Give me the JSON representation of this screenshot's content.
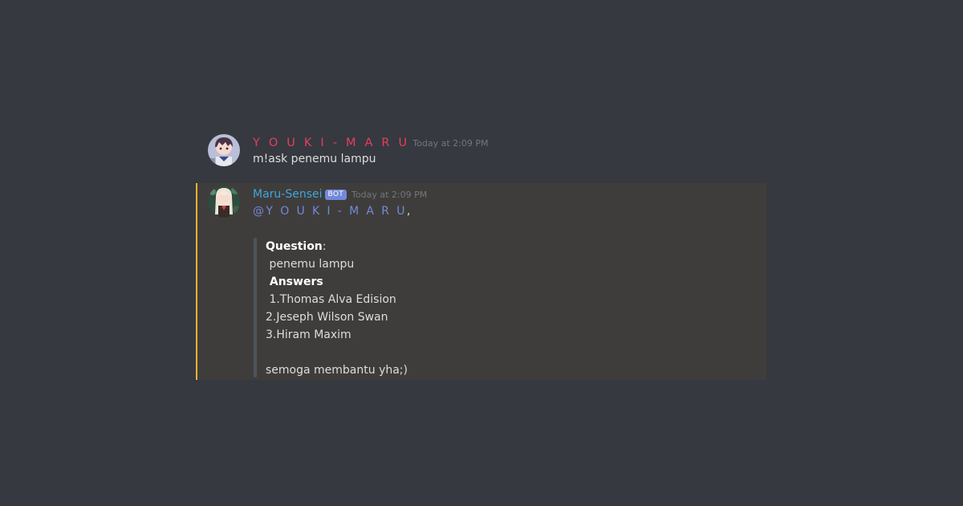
{
  "messages": [
    {
      "username": "Y O U K I - M A R U",
      "username_color": "#e53e5f",
      "timestamp": "Today at 2:09 PM",
      "content": "m!ask penemu lampu"
    },
    {
      "username": "Maru-Sensei",
      "username_color": "#3fa7e0",
      "bot_tag": "BOT",
      "timestamp": "Today at 2:09 PM",
      "mention": "@Y O U K I - M A R U",
      "mention_suffix": ",",
      "accent_color": "#f0b232",
      "quote": {
        "question_label": "Question",
        "question_colon": ":",
        "question_text": " penemu lampu",
        "answers_label": " Answers",
        "answers": [
          " 1.Thomas Alva Edision",
          "2.Jeseph Wilson Swan",
          "3.Hiram Maxim"
        ],
        "closing": "semoga membantu yha;)"
      }
    }
  ],
  "colors": {
    "background": "#36393f",
    "highlight_background": "#3f3d3b",
    "mention": "#7289da",
    "text": "#dcddde",
    "timestamp": "#72767d"
  },
  "icons": {
    "avatar_1": "anime-boy-avatar",
    "avatar_2": "anime-girl-avatar"
  }
}
